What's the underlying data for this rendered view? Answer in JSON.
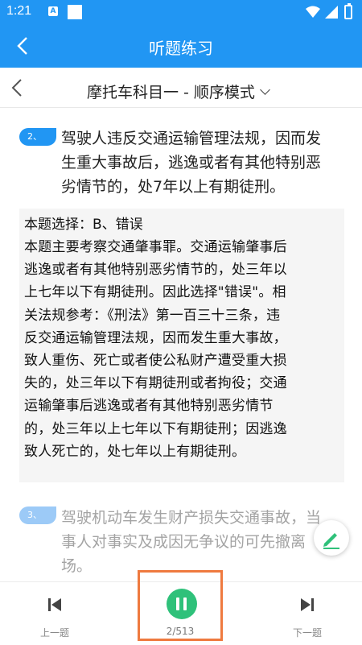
{
  "status": {
    "time": "1:21",
    "a_icon_label": "A"
  },
  "appbar": {
    "title": "听题练习"
  },
  "subheader": {
    "mode_label": "摩托车科目一 - 顺序模式"
  },
  "question2": {
    "number": "2、",
    "lines": [
      "驾驶人违反交通运输管理法规，因而发",
      "生重大事故后，逃逸或者有其他特别恶",
      "劣情节的，处7年以上有期徒刑。"
    ]
  },
  "answer": {
    "choice": "本题选择：B、错误",
    "lines": [
      "本题主要考察交通肇事罪。交通运输肇事后",
      "逃逸或者有其他特别恶劣情节的，处三年以",
      "上七年以下有期徒刑。因此选择\"错误\"。相",
      "关法规参考：《刑法》第一百三十三条，违",
      "反交通运输管理法规，因而发生重大事故，",
      "致人重伤、死亡或者使公私财产遭受重大损",
      "失的，处三年以下有期徒刑或者拘役；交通",
      "运输肇事后逃逸或者有其他特别恶劣情节",
      "的，处三年以上七年以下有期徒刑；因逃逸",
      "致人死亡的，处七年以上有期徒刑。"
    ]
  },
  "question3": {
    "number": "3、",
    "lines": [
      "驾驶机动车发生财产损失交通事故，当",
      "事人对事实及成因无争议的可先撤离",
      "场。"
    ]
  },
  "bottom": {
    "prev_label": "上一题",
    "next_label": "下一题",
    "page_count": "2/513"
  },
  "colors": {
    "primary": "#2196f3",
    "play": "#2fc17a",
    "highlight": "#ef7a3f"
  }
}
